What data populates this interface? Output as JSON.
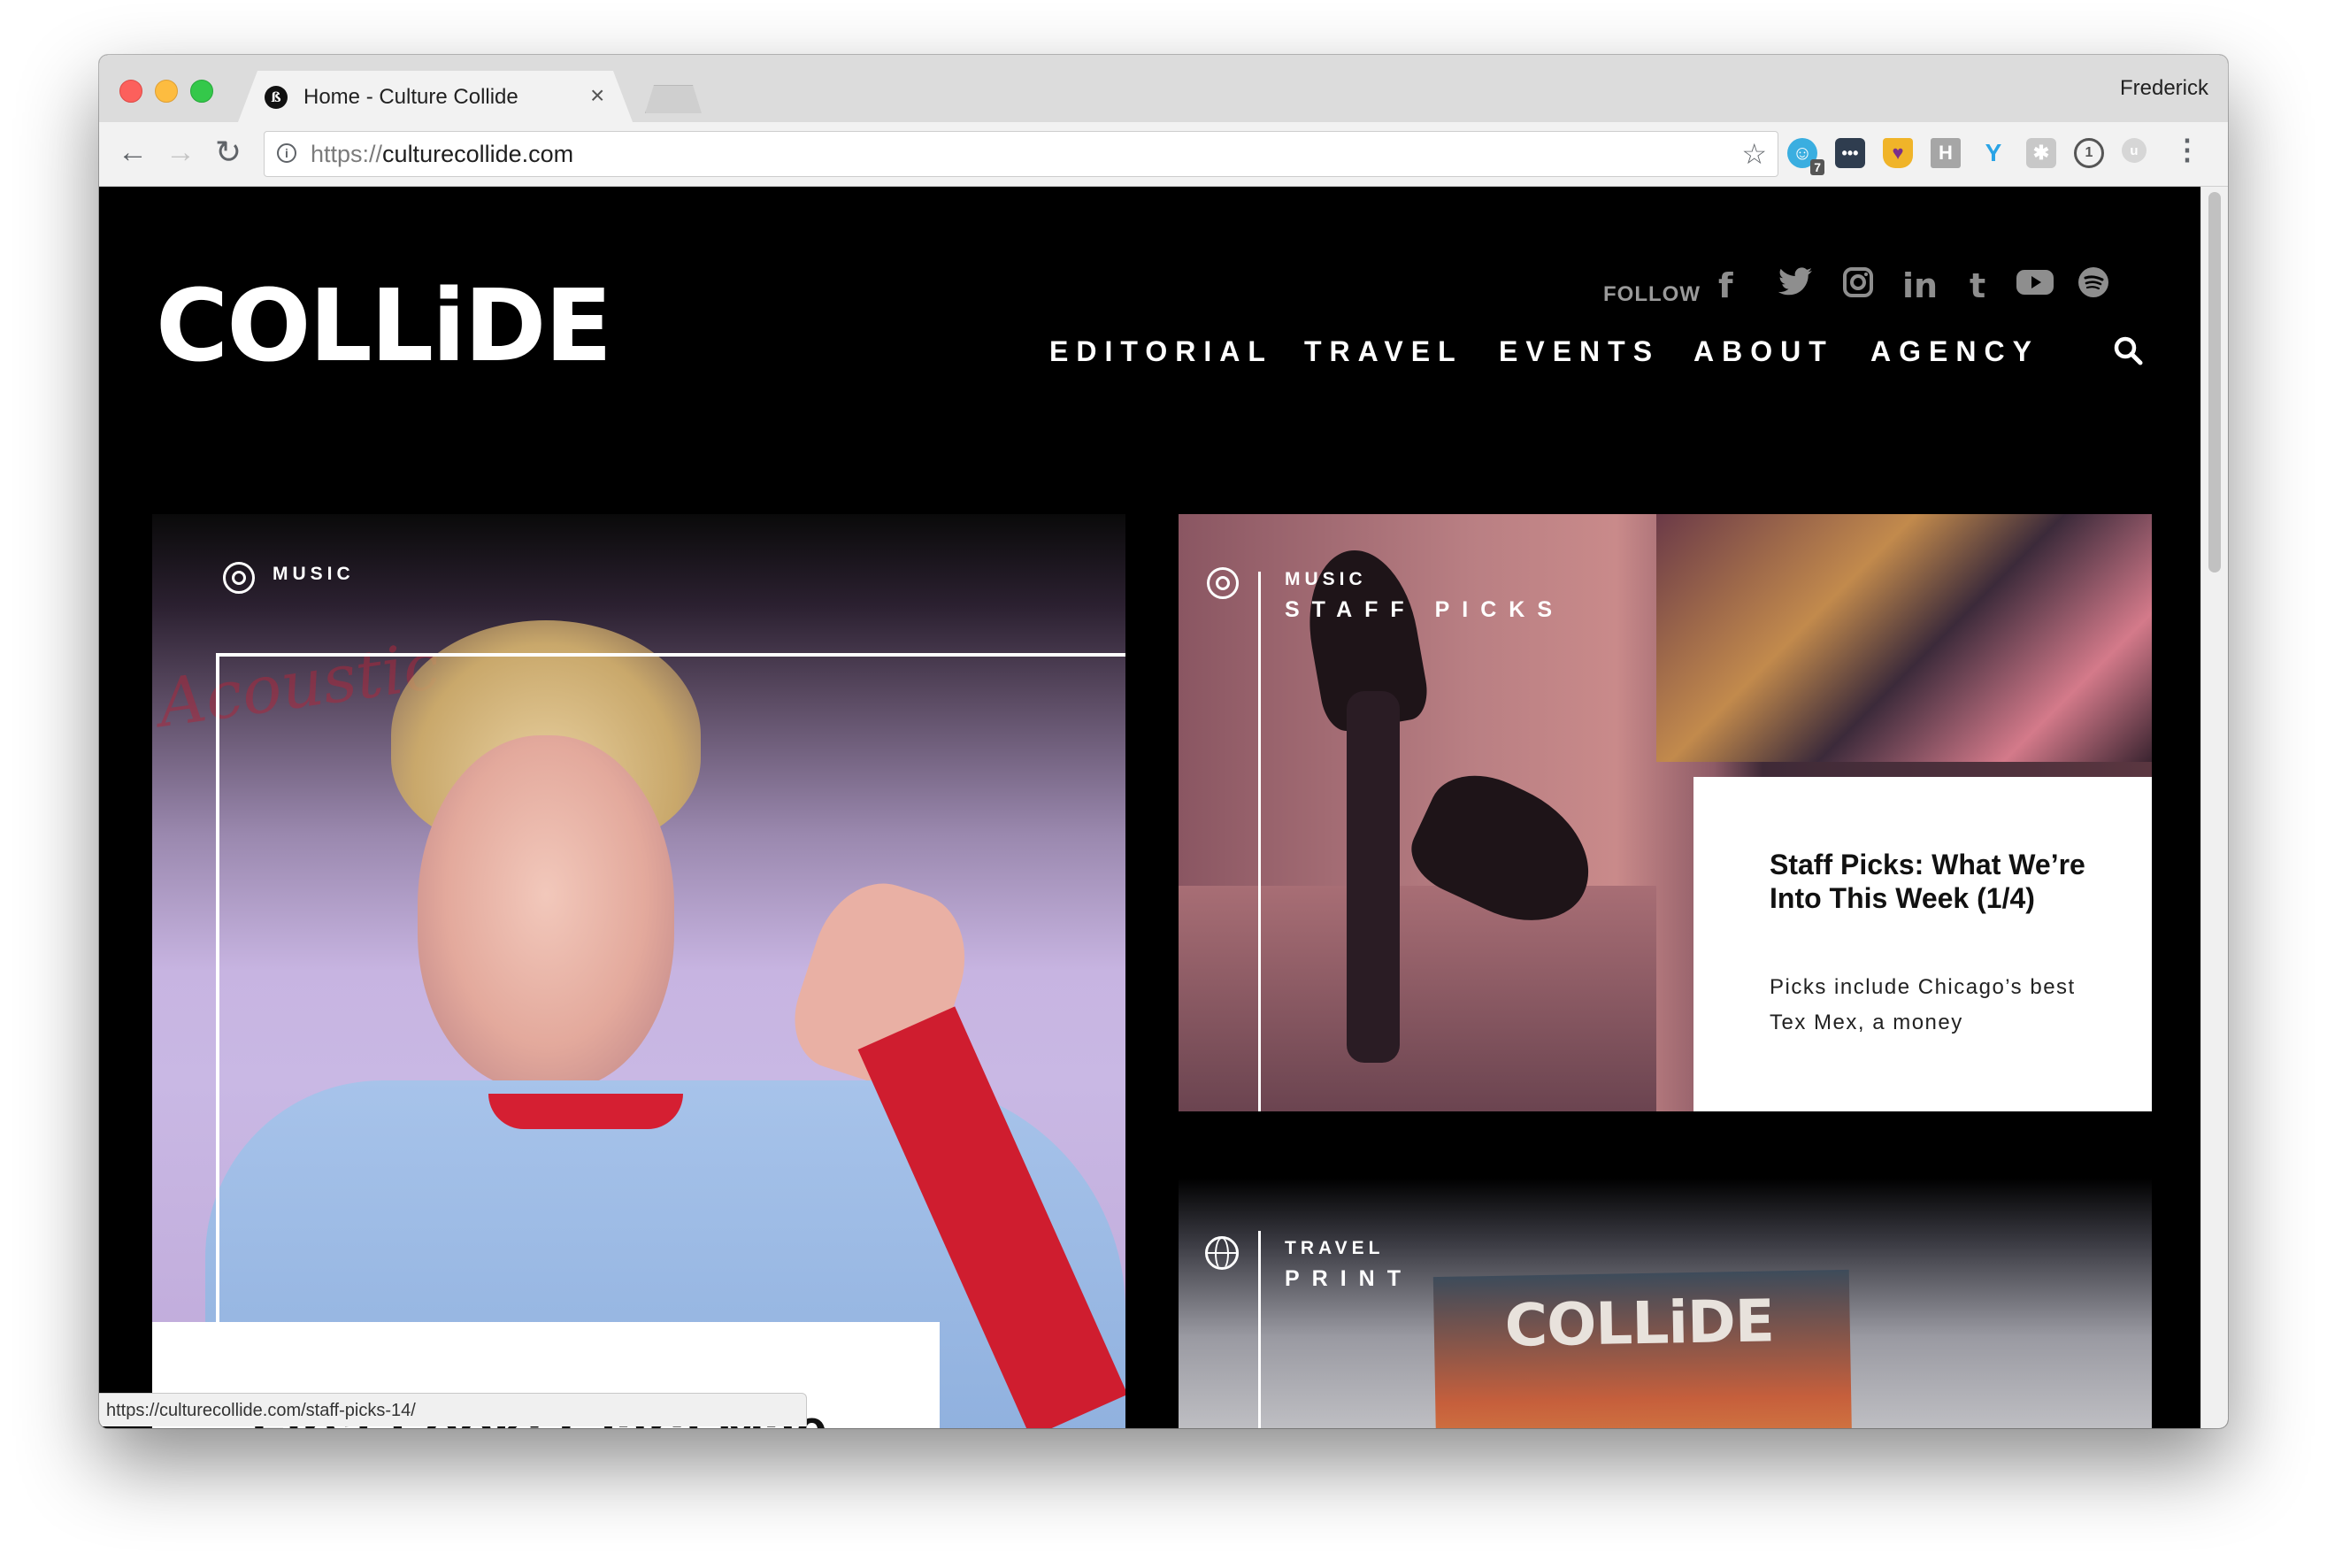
{
  "browser": {
    "tab_title": "Home - Culture Collide",
    "profile_name": "Frederick",
    "url_scheme": "https://",
    "url_host": "culturecollide.com",
    "status_url": "https://culturecollide.com/staff-picks-14/",
    "extension_badge": "7",
    "icons": [
      "back-arrow-icon",
      "forward-arrow-icon",
      "reload-icon",
      "info-icon",
      "star-icon",
      "ghostery-icon",
      "dots-icon",
      "cup-icon",
      "h-icon",
      "y-icon",
      "gear-icon",
      "one-password-icon",
      "u-icon",
      "kebab-menu-icon"
    ]
  },
  "site": {
    "logo": "COLLiDE",
    "follow_label": "FOLLOW",
    "social": [
      "facebook-icon",
      "twitter-icon",
      "instagram-icon",
      "linkedin-icon",
      "tumblr-icon",
      "youtube-icon",
      "spotify-icon"
    ],
    "nav": [
      "EDITORIAL",
      "TRAVEL",
      "EVENTS",
      "ABOUT",
      "AGENCY"
    ]
  },
  "cards": {
    "left": {
      "category": "MUSIC",
      "title": "First Look: Clara Mae",
      "image_script": "Acoustic"
    },
    "right1": {
      "category": "MUSIC",
      "subcategory": "STAFF PICKS",
      "title": "Staff Picks: What We’re Into This Week (1/4)",
      "excerpt": "Picks include Chicago’s best Tex Mex, a money"
    },
    "right2": {
      "category": "TRAVEL",
      "subcategory": "PRINT",
      "magazine_logo": "COLLiDE"
    }
  },
  "colors": {
    "page_bg": "#000000",
    "accent_red": "#cf1d2f",
    "chrome_bg": "#dcdcdc"
  }
}
